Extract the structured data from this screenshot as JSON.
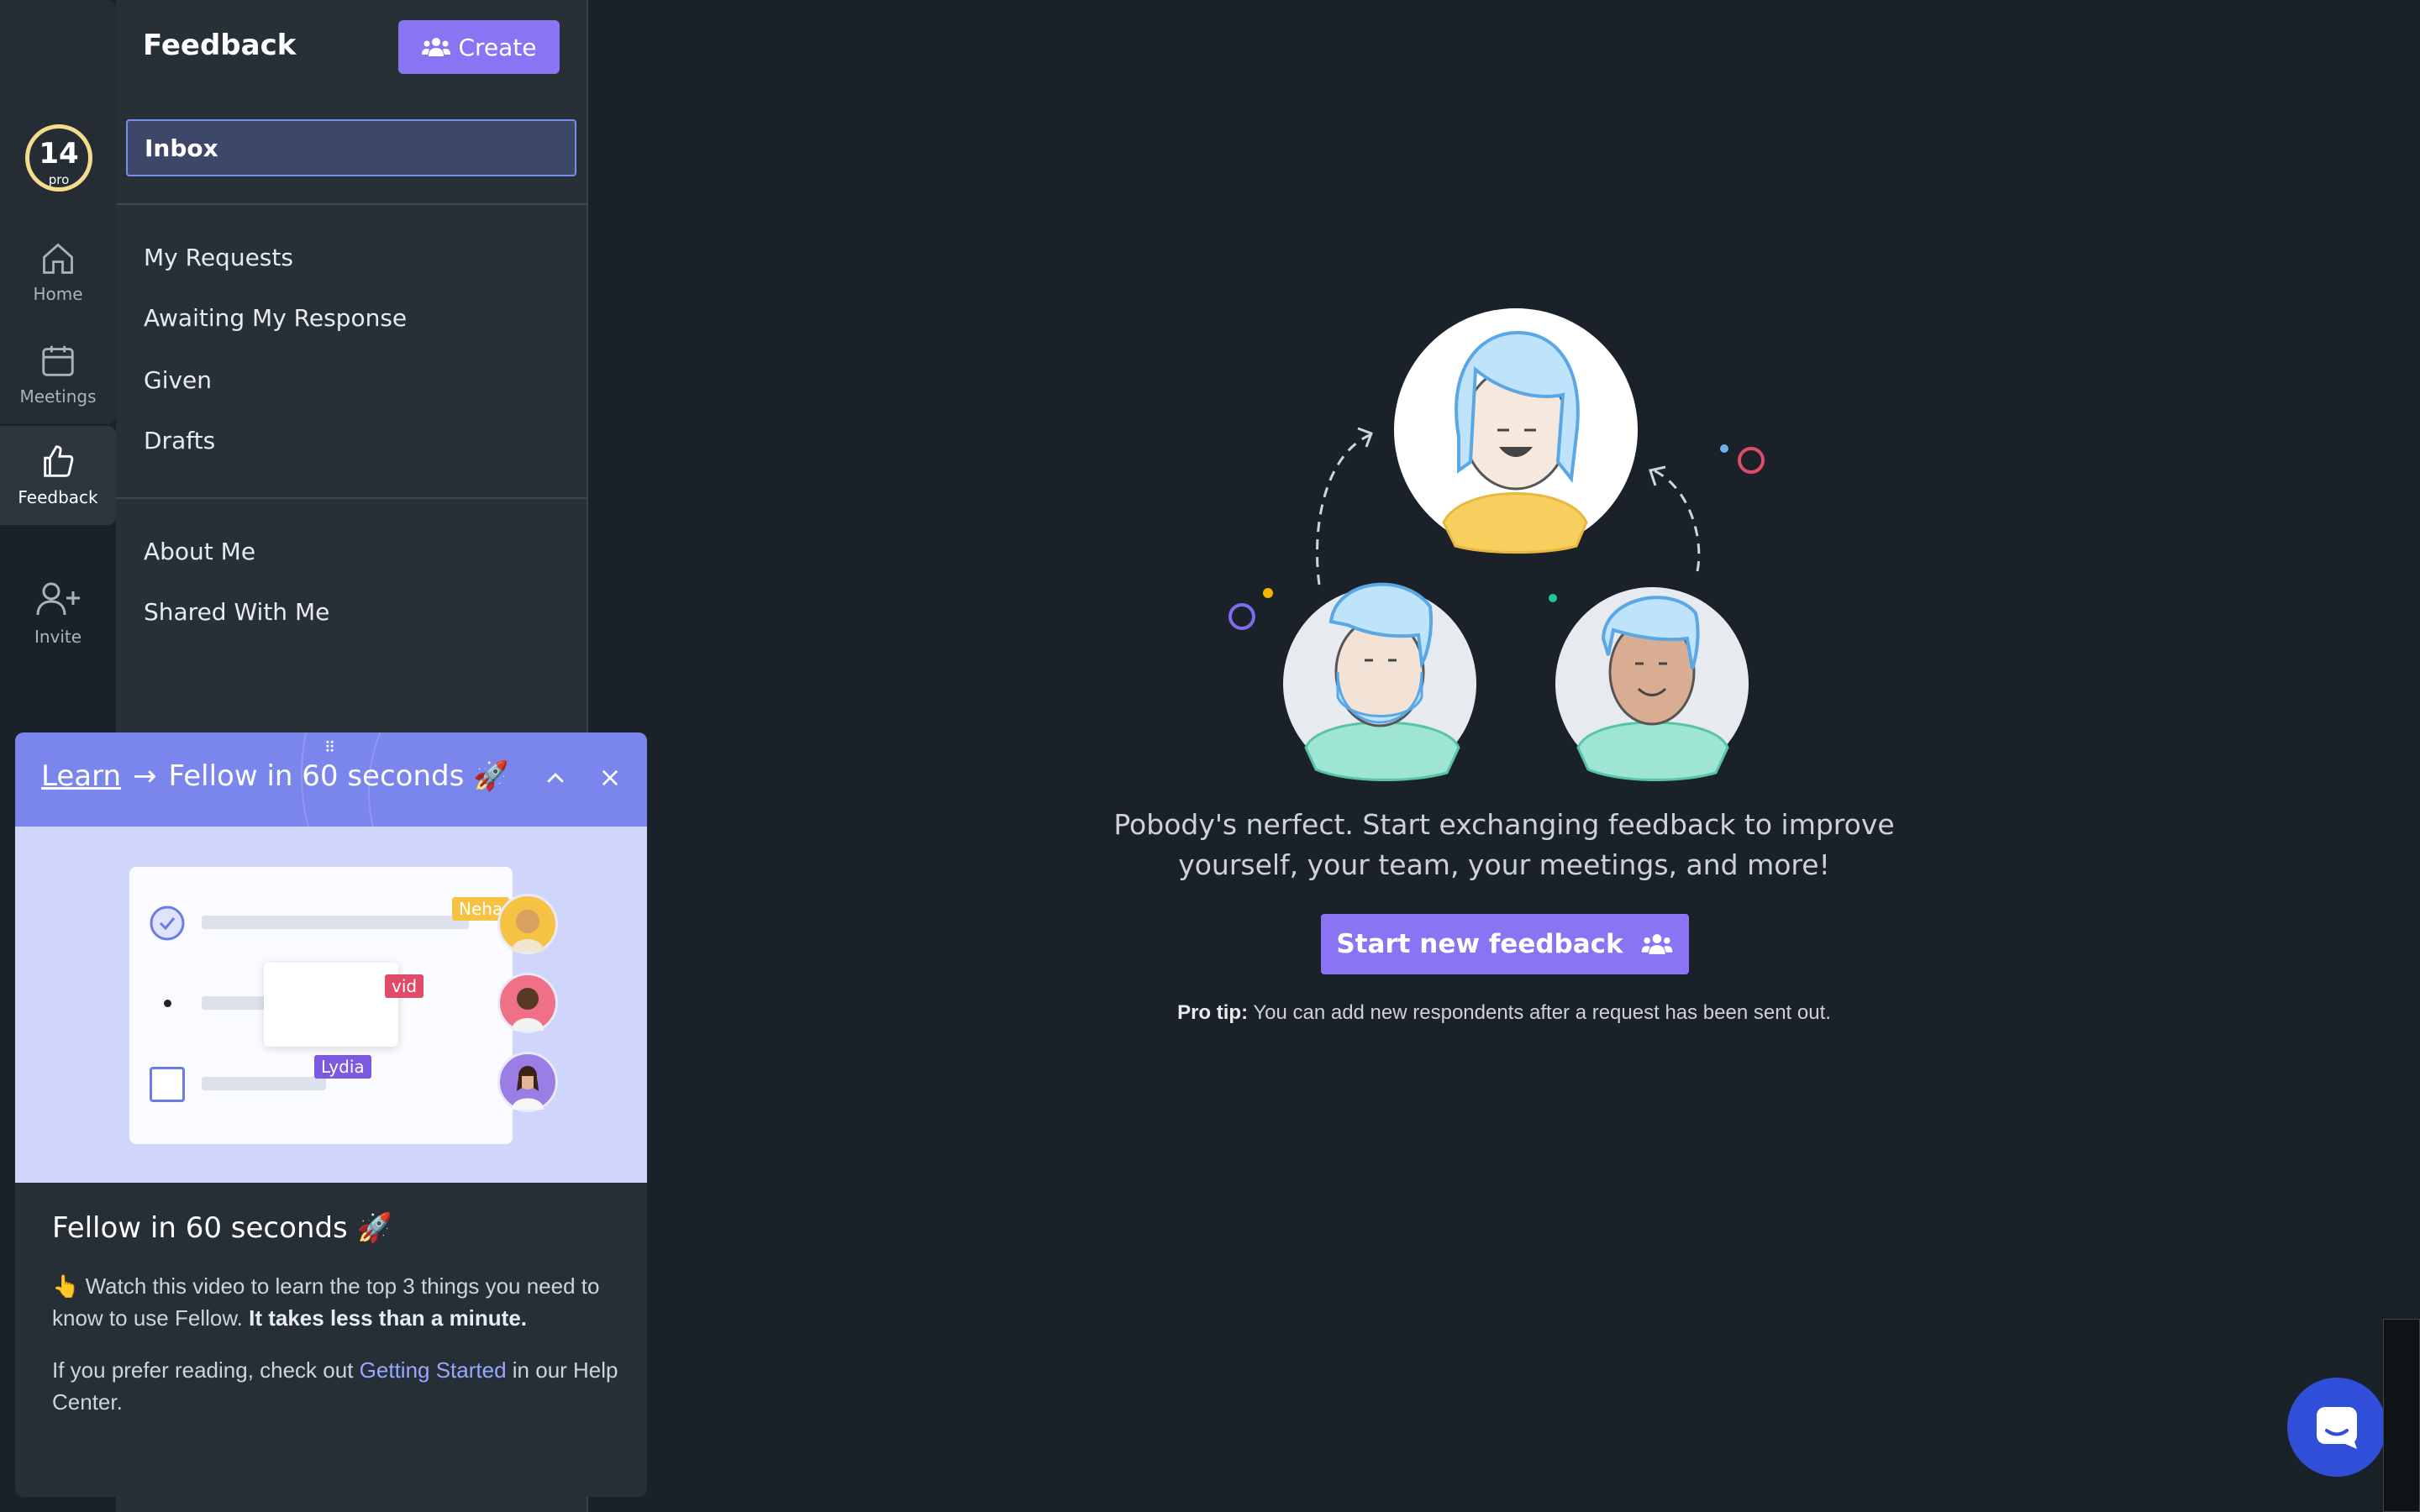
{
  "rail": {
    "badge_number": "14",
    "badge_label": "pro",
    "items": [
      {
        "label": "Home",
        "icon": "home-icon"
      },
      {
        "label": "Meetings",
        "icon": "calendar-icon"
      },
      {
        "label": "Feedback",
        "icon": "thumbs-up-icon"
      },
      {
        "label": "Invite",
        "icon": "add-user-icon"
      }
    ]
  },
  "sidebar": {
    "title": "Feedback",
    "create_label": "Create",
    "inbox_label": "Inbox",
    "items": [
      "My Requests",
      "Awaiting My Response",
      "Given",
      "Drafts"
    ],
    "items2": [
      "About Me",
      "Shared With Me"
    ]
  },
  "learn": {
    "link": "Learn",
    "title_head": "Fellow in 60 seconds 🚀",
    "card_title": "Fellow in 60 seconds 🚀",
    "p1_a": "👆 Watch this video to learn the top 3 things you need to know to use Fellow. ",
    "p1_b": "It takes less than a minute.",
    "p2_a": "If you prefer reading, check out ",
    "p2_link": "Getting Started",
    "p2_b": " in our Help Center.",
    "tags": [
      "Neha",
      "vid",
      "Lydia"
    ]
  },
  "main": {
    "message": "Pobody's nerfect. Start exchanging feedback to improve yourself, your team, your meetings, and more!",
    "start_button": "Start new feedback",
    "protip_label": "Pro tip:",
    "protip_text": " You can add new respondents after a request has been sent out."
  },
  "colors": {
    "accent": "#8b74f3",
    "learn_header": "#7b86ec",
    "badge_ring": "#f5dc8c",
    "chat": "#2f4fd8"
  }
}
